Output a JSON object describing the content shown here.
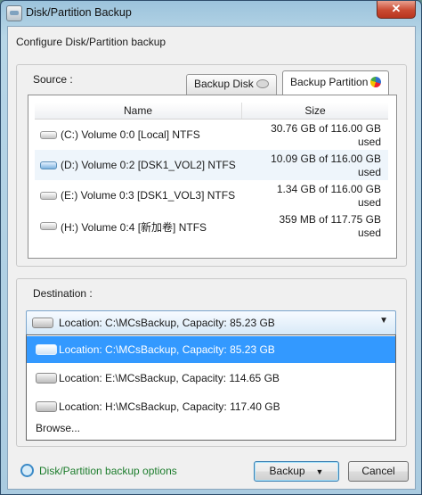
{
  "window": {
    "title": "Disk/Partition Backup",
    "close_glyph": "✕"
  },
  "heading": "Configure Disk/Partition backup",
  "source": {
    "label": "Source :",
    "tabs": [
      {
        "label": "Backup Disk",
        "icon": "disk-icon"
      },
      {
        "label": "Backup Partition",
        "icon": "pie-chart-icon",
        "active": true
      }
    ],
    "columns": {
      "name": "Name",
      "size": "Size"
    },
    "rows": [
      {
        "name": "(C:) Volume 0:0 [Local]  NTFS",
        "size": "30.76 GB of 116.00 GB used"
      },
      {
        "name": "(D:) Volume 0:2 [DSK1_VOL2]  NTFS",
        "size": "10.09 GB of 116.00 GB used",
        "selected": true
      },
      {
        "name": "(E:) Volume 0:3 [DSK1_VOL3]  NTFS",
        "size": "1.34 GB of 116.00 GB used"
      },
      {
        "name": "(H:) Volume 0:4 [新加卷]  NTFS",
        "size": "359 MB of 117.75 GB used"
      }
    ]
  },
  "destination": {
    "label": "Destination :",
    "selected": "Location: C:\\MCsBackup, Capacity: 85.23 GB",
    "options": [
      "Location: C:\\MCsBackup, Capacity: 85.23 GB",
      "Location: E:\\MCsBackup, Capacity: 114.65 GB",
      "Location: H:\\MCsBackup, Capacity: 117.40 GB"
    ],
    "browse": "Browse..."
  },
  "footer": {
    "options_link": "Disk/Partition backup options",
    "backup_label": "Backup",
    "backup_caret": "▼",
    "cancel_label": "Cancel"
  },
  "colors": {
    "highlight": "#3399ff",
    "link": "#1d7d2d",
    "close": "#c94a32"
  }
}
